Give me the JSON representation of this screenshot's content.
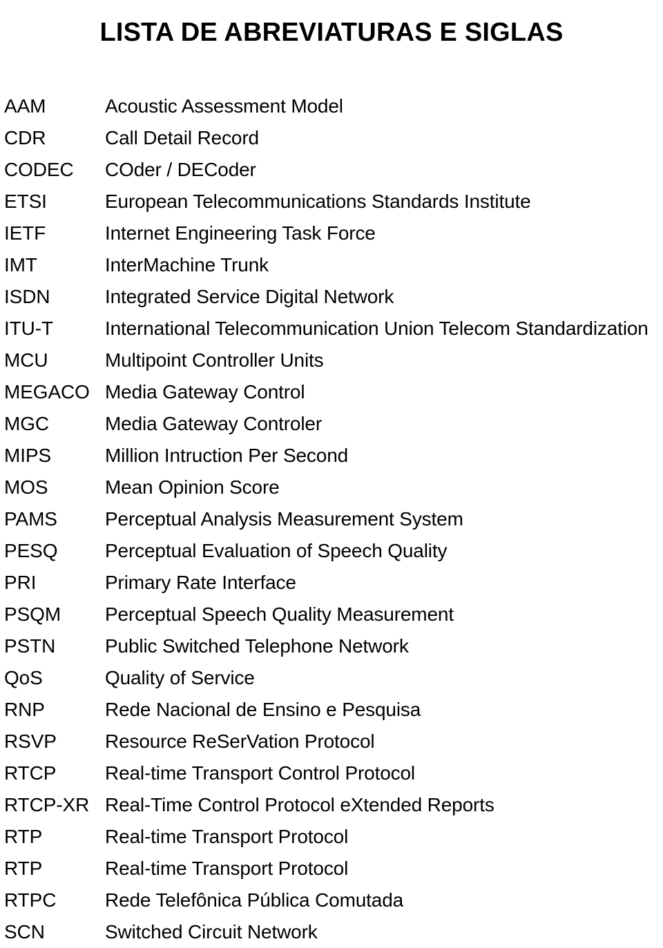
{
  "document": {
    "title": "LISTA DE ABREVIATURAS E SIGLAS",
    "text_color": "#000000",
    "background_color": "#ffffff"
  },
  "abbreviations": [
    {
      "term": "AAM",
      "definition": "Acoustic Assessment Model"
    },
    {
      "term": "CDR",
      "definition": "Call Detail Record"
    },
    {
      "term": "CODEC",
      "definition": "COder / DECoder"
    },
    {
      "term": "ETSI",
      "definition": "European Telecommunications Standards Institute"
    },
    {
      "term": "IETF",
      "definition": "Internet Engineering Task Force"
    },
    {
      "term": "IMT",
      "definition": "InterMachine Trunk"
    },
    {
      "term": "ISDN",
      "definition": "Integrated Service Digital Network"
    },
    {
      "term": "ITU-T",
      "definition": "International Telecommunication Union Telecom Standardization"
    },
    {
      "term": "MCU",
      "definition": "Multipoint Controller Units"
    },
    {
      "term": "MEGACO",
      "definition": "Media Gateway Control"
    },
    {
      "term": "MGC",
      "definition": "Media Gateway Controler"
    },
    {
      "term": "MIPS",
      "definition": "Million Intruction Per Second"
    },
    {
      "term": "MOS",
      "definition": "Mean Opinion Score"
    },
    {
      "term": "PAMS",
      "definition": "Perceptual Analysis Measurement System"
    },
    {
      "term": "PESQ",
      "definition": "Perceptual Evaluation of Speech Quality"
    },
    {
      "term": "PRI",
      "definition": "Primary Rate Interface"
    },
    {
      "term": "PSQM",
      "definition": "Perceptual Speech Quality Measurement"
    },
    {
      "term": "PSTN",
      "definition": "Public Switched Telephone Network"
    },
    {
      "term": "QoS",
      "definition": "Quality of Service"
    },
    {
      "term": "RNP",
      "definition": "Rede Nacional de Ensino e Pesquisa"
    },
    {
      "term": "RSVP",
      "definition": "Resource ReSerVation Protocol"
    },
    {
      "term": "RTCP",
      "definition": "Real-time Transport Control Protocol"
    },
    {
      "term": "RTCP-XR",
      "definition": "Real-Time Control Protocol eXtended Reports"
    },
    {
      "term": "RTP",
      "definition": "Real-time Transport Protocol"
    },
    {
      "term": "RTP",
      "definition": "Real-time Transport Protocol"
    },
    {
      "term": "RTPC",
      "definition": "Rede Telefônica Pública Comutada"
    },
    {
      "term": "SCN",
      "definition": "Switched Circuit Network"
    }
  ]
}
